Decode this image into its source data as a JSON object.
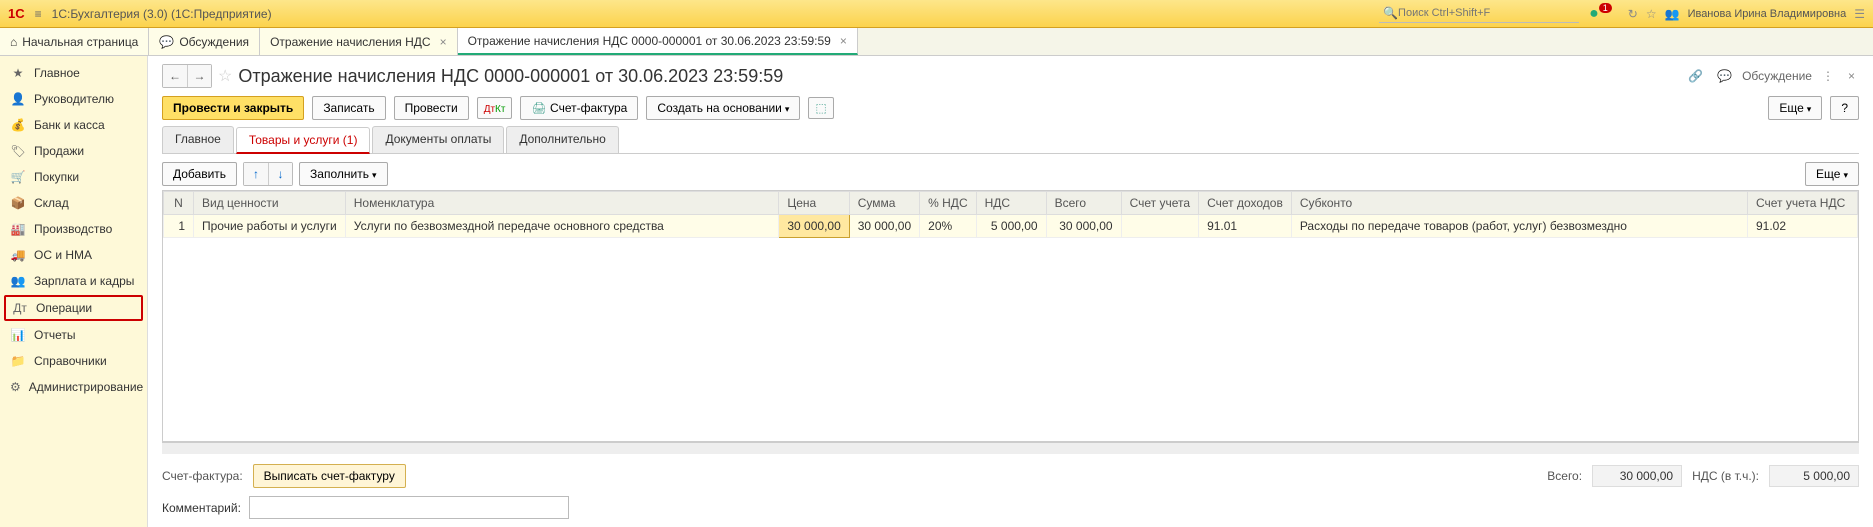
{
  "app": {
    "logo": "1C",
    "title": "1С:Бухгалтерия (3.0)  (1С:Предприятие)",
    "search_placeholder": "Поиск Ctrl+Shift+F",
    "notif_count": "1",
    "username": "Иванова Ирина Владимировна"
  },
  "tabs": {
    "home": "Начальная страница",
    "discuss": "Обсуждения",
    "t1": "Отражение начисления НДС",
    "t2": "Отражение начисления НДС 0000-000001 от 30.06.2023 23:59:59"
  },
  "sidebar": {
    "main": "Главное",
    "director": "Руководителю",
    "bank": "Банк и касса",
    "sales": "Продажи",
    "purchases": "Покупки",
    "warehouse": "Склад",
    "production": "Производство",
    "osnma": "ОС и НМА",
    "salary": "Зарплата и кадры",
    "operations": "Операции",
    "reports": "Отчеты",
    "directories": "Справочники",
    "admin": "Администрирование"
  },
  "doc": {
    "title": "Отражение начисления НДС 0000-000001 от 30.06.2023 23:59:59",
    "discuss": "Обсуждение"
  },
  "toolbar": {
    "post_close": "Провести и закрыть",
    "save": "Записать",
    "post": "Провести",
    "invoice": "Счет-фактура",
    "create_based": "Создать на основании",
    "more": "Еще",
    "help": "?"
  },
  "innertabs": {
    "main": "Главное",
    "goods": "Товары и услуги (1)",
    "payments": "Документы оплаты",
    "additional": "Дополнительно"
  },
  "tbl_toolbar": {
    "add": "Добавить",
    "fill": "Заполнить",
    "more": "Еще"
  },
  "columns": {
    "n": "N",
    "type": "Вид ценности",
    "nomen": "Номенклатура",
    "price": "Цена",
    "sum": "Сумма",
    "vat": "% НДС",
    "nds": "НДС",
    "total": "Всего",
    "acct": "Счет учета",
    "acct_income": "Счет доходов",
    "subconto": "Субконто",
    "acct_nds": "Счет учета НДС"
  },
  "row": {
    "n": "1",
    "type": "Прочие работы и услуги",
    "nomen": "Услуги по безвозмездной передаче основного средства",
    "price": "30 000,00",
    "sum": "30 000,00",
    "vat": "20%",
    "nds": "5 000,00",
    "total": "30 000,00",
    "acct": "",
    "acct_income": "91.01",
    "subconto": "Расходы по передаче товаров (работ, услуг) безвозмездно",
    "acct_nds": "91.02"
  },
  "footer": {
    "invoice_label": "Счет-фактура:",
    "issue_invoice": "Выписать счет-фактуру",
    "total_label": "Всего:",
    "total_value": "30 000,00",
    "nds_label": "НДС (в т.ч.):",
    "nds_value": "5 000,00",
    "comment_label": "Комментарий:"
  }
}
